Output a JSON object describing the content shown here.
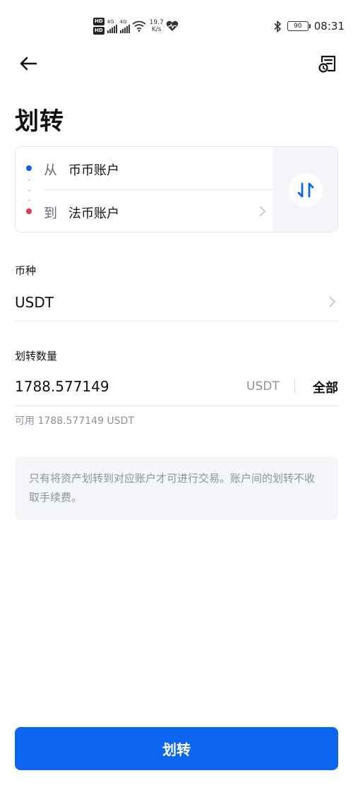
{
  "status_bar": {
    "hd_badge_1": "HD",
    "hd_badge_2": "HD",
    "net_type_1": "4G",
    "net_type_2": "4G",
    "speed_value": "19.7",
    "speed_unit": "K/s",
    "battery": "90",
    "time": "08:31",
    "icons": [
      "hd-icon",
      "signal-icon",
      "wifi-icon",
      "heart-icon",
      "bluetooth-icon",
      "battery-icon"
    ]
  },
  "nav": {
    "back_icon": "arrow-left-icon",
    "record_icon": "transfer-record-icon"
  },
  "page": {
    "title": "划转"
  },
  "transfer": {
    "from_prefix": "从",
    "from_account": "币币账户",
    "to_prefix": "到",
    "to_account": "法币账户",
    "swap_icon": "swap-icon"
  },
  "coin": {
    "label": "币种",
    "value": "USDT"
  },
  "amount": {
    "label": "划转数量",
    "value": "1788.577149",
    "unit": "USDT",
    "max_label": "全部",
    "available": "可用 1788.577149 USDT"
  },
  "notice": {
    "text": "只有将资产划转到对应账户才可进行交易。账户间的划转不收取手续费。"
  },
  "submit": {
    "label": "划转"
  },
  "colors": {
    "primary": "#0c65f0",
    "from_dot": "#1a5ce6",
    "to_dot": "#d63b5a",
    "muted_text": "#8b929e",
    "notice_bg": "#f5f6f9"
  }
}
